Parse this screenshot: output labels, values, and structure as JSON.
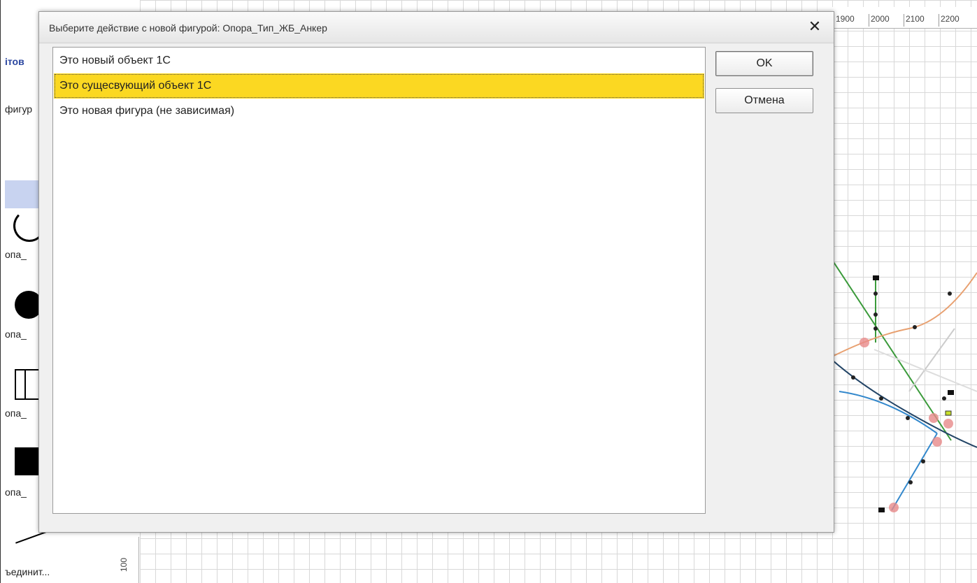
{
  "left_panel": {
    "title": "ітов",
    "figures_label": "фигур",
    "shape_labels": [
      "опа_",
      "опа_",
      "опа_",
      "опа_"
    ],
    "connect_label": "ъединит..."
  },
  "ruler": {
    "top_ticks": [
      "1900",
      "2000",
      "2100",
      "2200"
    ],
    "left_tick": "100"
  },
  "dialog": {
    "title": "Выберите действие с новой фигурой: Опора_Тип_ЖБ_Анкер",
    "close_symbol": "✕",
    "options": [
      "Это новый объект 1С",
      "Это сущесвующий объект 1С",
      "Это новая фигура (не зависимая)"
    ],
    "selected_option": "Это сущесвующий объект 1С",
    "ok_label": "OK",
    "cancel_label": "Отмена",
    "selected_color": "#fbd822"
  }
}
